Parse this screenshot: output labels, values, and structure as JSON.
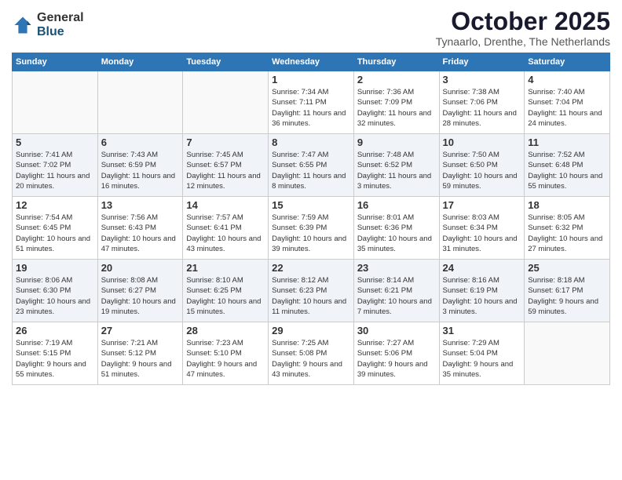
{
  "header": {
    "logo_general": "General",
    "logo_blue": "Blue",
    "month_title": "October 2025",
    "location": "Tynaarlo, Drenthe, The Netherlands"
  },
  "days_of_week": [
    "Sunday",
    "Monday",
    "Tuesday",
    "Wednesday",
    "Thursday",
    "Friday",
    "Saturday"
  ],
  "weeks": [
    [
      {
        "date": "",
        "sunrise": "",
        "sunset": "",
        "daylight": ""
      },
      {
        "date": "",
        "sunrise": "",
        "sunset": "",
        "daylight": ""
      },
      {
        "date": "",
        "sunrise": "",
        "sunset": "",
        "daylight": ""
      },
      {
        "date": "1",
        "sunrise": "Sunrise: 7:34 AM",
        "sunset": "Sunset: 7:11 PM",
        "daylight": "Daylight: 11 hours and 36 minutes."
      },
      {
        "date": "2",
        "sunrise": "Sunrise: 7:36 AM",
        "sunset": "Sunset: 7:09 PM",
        "daylight": "Daylight: 11 hours and 32 minutes."
      },
      {
        "date": "3",
        "sunrise": "Sunrise: 7:38 AM",
        "sunset": "Sunset: 7:06 PM",
        "daylight": "Daylight: 11 hours and 28 minutes."
      },
      {
        "date": "4",
        "sunrise": "Sunrise: 7:40 AM",
        "sunset": "Sunset: 7:04 PM",
        "daylight": "Daylight: 11 hours and 24 minutes."
      }
    ],
    [
      {
        "date": "5",
        "sunrise": "Sunrise: 7:41 AM",
        "sunset": "Sunset: 7:02 PM",
        "daylight": "Daylight: 11 hours and 20 minutes."
      },
      {
        "date": "6",
        "sunrise": "Sunrise: 7:43 AM",
        "sunset": "Sunset: 6:59 PM",
        "daylight": "Daylight: 11 hours and 16 minutes."
      },
      {
        "date": "7",
        "sunrise": "Sunrise: 7:45 AM",
        "sunset": "Sunset: 6:57 PM",
        "daylight": "Daylight: 11 hours and 12 minutes."
      },
      {
        "date": "8",
        "sunrise": "Sunrise: 7:47 AM",
        "sunset": "Sunset: 6:55 PM",
        "daylight": "Daylight: 11 hours and 8 minutes."
      },
      {
        "date": "9",
        "sunrise": "Sunrise: 7:48 AM",
        "sunset": "Sunset: 6:52 PM",
        "daylight": "Daylight: 11 hours and 3 minutes."
      },
      {
        "date": "10",
        "sunrise": "Sunrise: 7:50 AM",
        "sunset": "Sunset: 6:50 PM",
        "daylight": "Daylight: 10 hours and 59 minutes."
      },
      {
        "date": "11",
        "sunrise": "Sunrise: 7:52 AM",
        "sunset": "Sunset: 6:48 PM",
        "daylight": "Daylight: 10 hours and 55 minutes."
      }
    ],
    [
      {
        "date": "12",
        "sunrise": "Sunrise: 7:54 AM",
        "sunset": "Sunset: 6:45 PM",
        "daylight": "Daylight: 10 hours and 51 minutes."
      },
      {
        "date": "13",
        "sunrise": "Sunrise: 7:56 AM",
        "sunset": "Sunset: 6:43 PM",
        "daylight": "Daylight: 10 hours and 47 minutes."
      },
      {
        "date": "14",
        "sunrise": "Sunrise: 7:57 AM",
        "sunset": "Sunset: 6:41 PM",
        "daylight": "Daylight: 10 hours and 43 minutes."
      },
      {
        "date": "15",
        "sunrise": "Sunrise: 7:59 AM",
        "sunset": "Sunset: 6:39 PM",
        "daylight": "Daylight: 10 hours and 39 minutes."
      },
      {
        "date": "16",
        "sunrise": "Sunrise: 8:01 AM",
        "sunset": "Sunset: 6:36 PM",
        "daylight": "Daylight: 10 hours and 35 minutes."
      },
      {
        "date": "17",
        "sunrise": "Sunrise: 8:03 AM",
        "sunset": "Sunset: 6:34 PM",
        "daylight": "Daylight: 10 hours and 31 minutes."
      },
      {
        "date": "18",
        "sunrise": "Sunrise: 8:05 AM",
        "sunset": "Sunset: 6:32 PM",
        "daylight": "Daylight: 10 hours and 27 minutes."
      }
    ],
    [
      {
        "date": "19",
        "sunrise": "Sunrise: 8:06 AM",
        "sunset": "Sunset: 6:30 PM",
        "daylight": "Daylight: 10 hours and 23 minutes."
      },
      {
        "date": "20",
        "sunrise": "Sunrise: 8:08 AM",
        "sunset": "Sunset: 6:27 PM",
        "daylight": "Daylight: 10 hours and 19 minutes."
      },
      {
        "date": "21",
        "sunrise": "Sunrise: 8:10 AM",
        "sunset": "Sunset: 6:25 PM",
        "daylight": "Daylight: 10 hours and 15 minutes."
      },
      {
        "date": "22",
        "sunrise": "Sunrise: 8:12 AM",
        "sunset": "Sunset: 6:23 PM",
        "daylight": "Daylight: 10 hours and 11 minutes."
      },
      {
        "date": "23",
        "sunrise": "Sunrise: 8:14 AM",
        "sunset": "Sunset: 6:21 PM",
        "daylight": "Daylight: 10 hours and 7 minutes."
      },
      {
        "date": "24",
        "sunrise": "Sunrise: 8:16 AM",
        "sunset": "Sunset: 6:19 PM",
        "daylight": "Daylight: 10 hours and 3 minutes."
      },
      {
        "date": "25",
        "sunrise": "Sunrise: 8:18 AM",
        "sunset": "Sunset: 6:17 PM",
        "daylight": "Daylight: 9 hours and 59 minutes."
      }
    ],
    [
      {
        "date": "26",
        "sunrise": "Sunrise: 7:19 AM",
        "sunset": "Sunset: 5:15 PM",
        "daylight": "Daylight: 9 hours and 55 minutes."
      },
      {
        "date": "27",
        "sunrise": "Sunrise: 7:21 AM",
        "sunset": "Sunset: 5:12 PM",
        "daylight": "Daylight: 9 hours and 51 minutes."
      },
      {
        "date": "28",
        "sunrise": "Sunrise: 7:23 AM",
        "sunset": "Sunset: 5:10 PM",
        "daylight": "Daylight: 9 hours and 47 minutes."
      },
      {
        "date": "29",
        "sunrise": "Sunrise: 7:25 AM",
        "sunset": "Sunset: 5:08 PM",
        "daylight": "Daylight: 9 hours and 43 minutes."
      },
      {
        "date": "30",
        "sunrise": "Sunrise: 7:27 AM",
        "sunset": "Sunset: 5:06 PM",
        "daylight": "Daylight: 9 hours and 39 minutes."
      },
      {
        "date": "31",
        "sunrise": "Sunrise: 7:29 AM",
        "sunset": "Sunset: 5:04 PM",
        "daylight": "Daylight: 9 hours and 35 minutes."
      },
      {
        "date": "",
        "sunrise": "",
        "sunset": "",
        "daylight": ""
      }
    ]
  ]
}
